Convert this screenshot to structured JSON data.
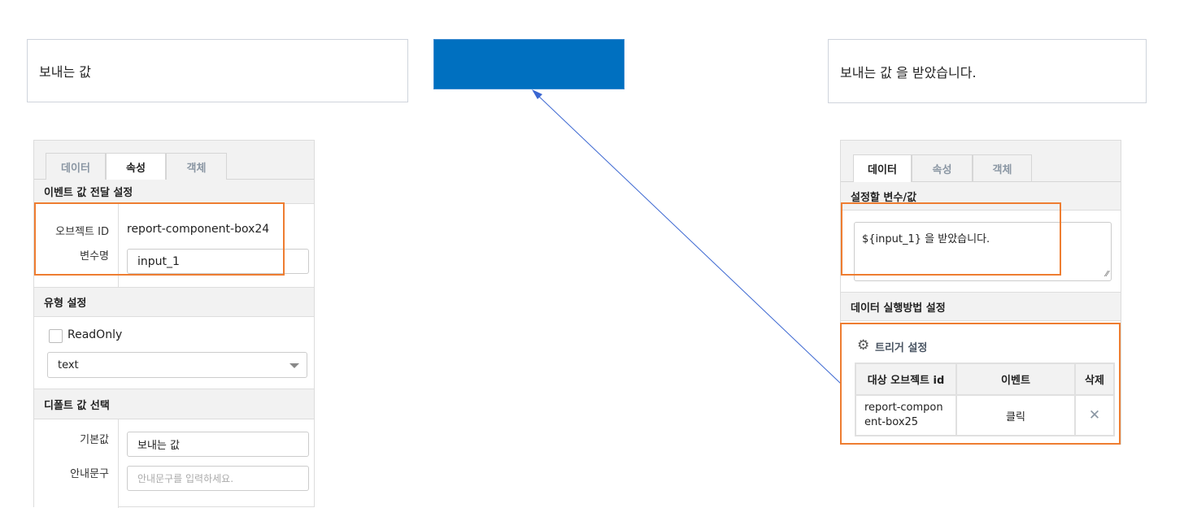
{
  "canvas": {
    "sender_box_text": "보내는 값",
    "receiver_box_text": "보내는 값  을 받았습니다."
  },
  "left_panel": {
    "tabs": [
      "데이터",
      "속성",
      "객체"
    ],
    "active_tab": "속성",
    "event_section": {
      "title": "이벤트 값 전달 설정",
      "object_id_label": "오브젝트 ID",
      "object_id_value": "report-component-box24",
      "variable_label": "변수명",
      "variable_value": "input_1"
    },
    "type_section": {
      "title": "유형 설정",
      "readonly_label": "ReadOnly",
      "readonly_checked": false,
      "type_value": "text"
    },
    "default_section": {
      "title": "디폴트 값 선택",
      "default_label": "기본값",
      "default_value": "보내는 값",
      "hint_label": "안내문구",
      "hint_placeholder": "안내문구를 입력하세요."
    }
  },
  "right_panel": {
    "tabs": [
      "데이터",
      "속성",
      "객체"
    ],
    "active_tab": "데이터",
    "value_section": {
      "title": "설정할 변수/값",
      "value": "${input_1}  을 받았습니다."
    },
    "exec_section": {
      "title": "데이터 실행방법 설정"
    },
    "trigger": {
      "title": "트리거 설정",
      "headers": [
        "대상 오브젝트 id",
        "이벤트",
        "삭제"
      ],
      "rows": [
        {
          "target": "report-component-box25",
          "event": "클릭"
        }
      ]
    }
  },
  "colors": {
    "accent": "#0070c0",
    "highlight": "#ee7d31",
    "arrow": "#3a66d1"
  }
}
